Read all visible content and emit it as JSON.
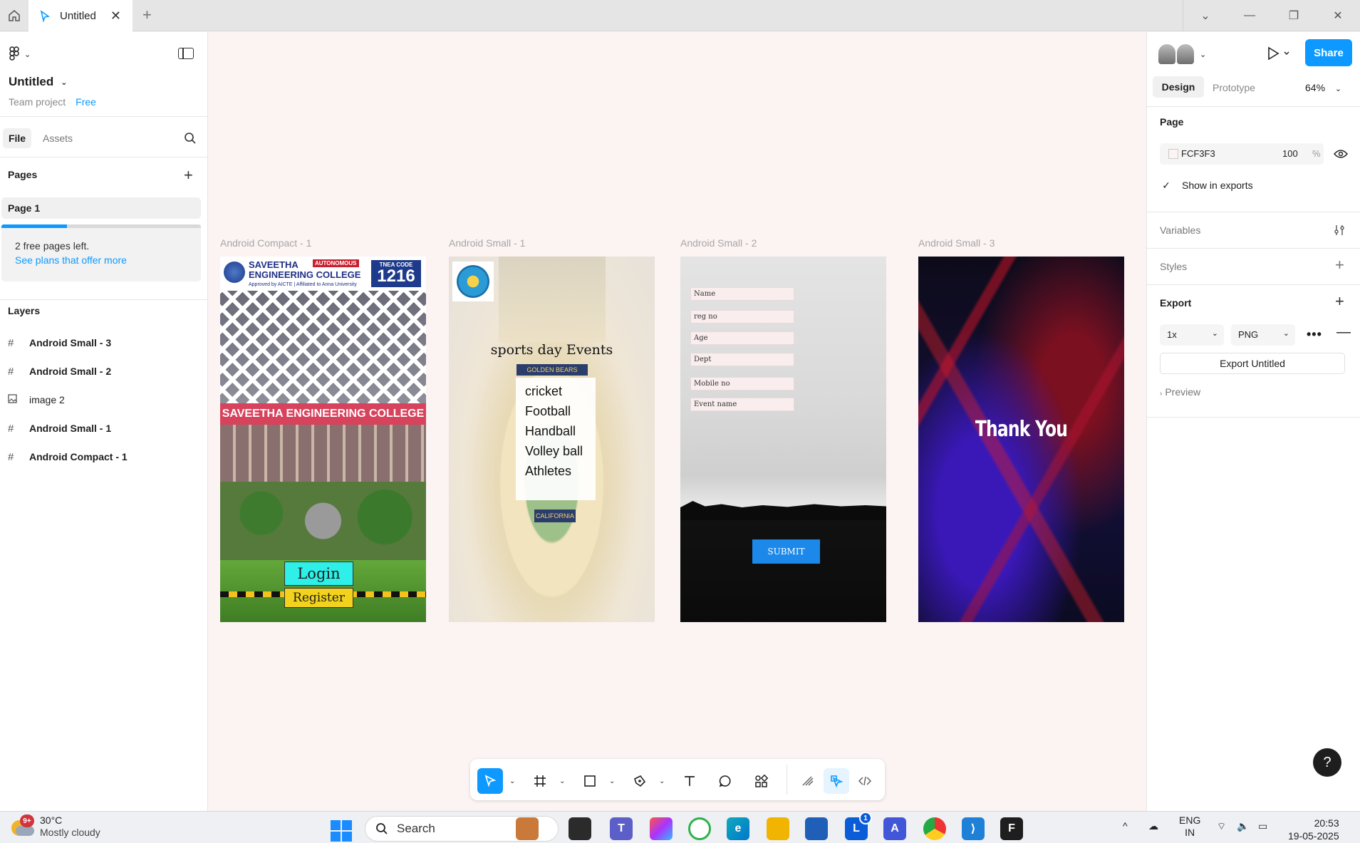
{
  "tabs": {
    "active_label": "Untitled"
  },
  "file": {
    "title": "Untitled",
    "team": "Team project",
    "plan": "Free"
  },
  "left_panel": {
    "seg_file": "File",
    "seg_assets": "Assets",
    "pages_heading": "Pages",
    "pages": [
      "Page 1"
    ],
    "notice_line1": "2 free pages left.",
    "notice_link": "See plans that offer more",
    "free_pages_used_fraction": 0.33,
    "layers_heading": "Layers",
    "layers": [
      {
        "icon": "frame-icon",
        "label": "Android Small - 3"
      },
      {
        "icon": "frame-icon",
        "label": "Android Small - 2"
      },
      {
        "icon": "image-icon",
        "label": "image 2"
      },
      {
        "icon": "frame-icon",
        "label": "Android Small - 1"
      },
      {
        "icon": "frame-icon",
        "label": "Android Compact - 1"
      }
    ]
  },
  "canvas": {
    "background": "#FCF3F3",
    "frames": {
      "f1": {
        "label": "Android Compact - 1",
        "college_line1": "SAVEETHA",
        "college_line2": "ENGINEERING COLLEGE",
        "autonomous": "AUTONOMOUS",
        "approved": "Approved by AICTE | Affiliated to Anna University",
        "tnea_label": "TNEA CODE",
        "tnea_code": "1216",
        "nameboard": "SAVEETHA ENGINEERING COLLEGE",
        "login": "Login",
        "register": "Register"
      },
      "f2": {
        "label": "Android Small - 1",
        "title": "sports day Events",
        "golden": "GOLDEN BEARS",
        "events": [
          "cricket",
          "Football",
          "Handball",
          "Volley ball",
          "Athletes"
        ],
        "cal": "CALIFORNIA"
      },
      "f3": {
        "label": "Android Small - 2",
        "fields": [
          "Name",
          "reg no",
          "Age",
          "Dept",
          "Mobile no",
          "Event name"
        ],
        "submit": "SUBMIT"
      },
      "f4": {
        "label": "Android Small - 3",
        "text": "Thank You"
      }
    }
  },
  "right_panel": {
    "share": "Share",
    "tab_design": "Design",
    "tab_prototype": "Prototype",
    "zoom": "64%",
    "page_heading": "Page",
    "page_color": "FCF3F3",
    "page_opacity": "100",
    "percent_sign": "%",
    "show_in_exports": "Show in exports",
    "variables": "Variables",
    "styles": "Styles",
    "export_heading": "Export",
    "export_scale": "1x",
    "export_format": "PNG",
    "export_button": "Export Untitled",
    "preview": "Preview",
    "help": "?"
  },
  "taskbar": {
    "badge": "9+",
    "temp": "30°C",
    "weather": "Mostly cloudy",
    "search": "Search",
    "lang1": "ENG",
    "lang2": "IN",
    "time": "20:53",
    "date": "19-05-2025",
    "notif_count": "1"
  },
  "colors": {
    "accent": "#0d99ff",
    "login_bg": "#2ef0e8",
    "register_bg": "#f2d21c",
    "submit_bg": "#1b88ea"
  }
}
